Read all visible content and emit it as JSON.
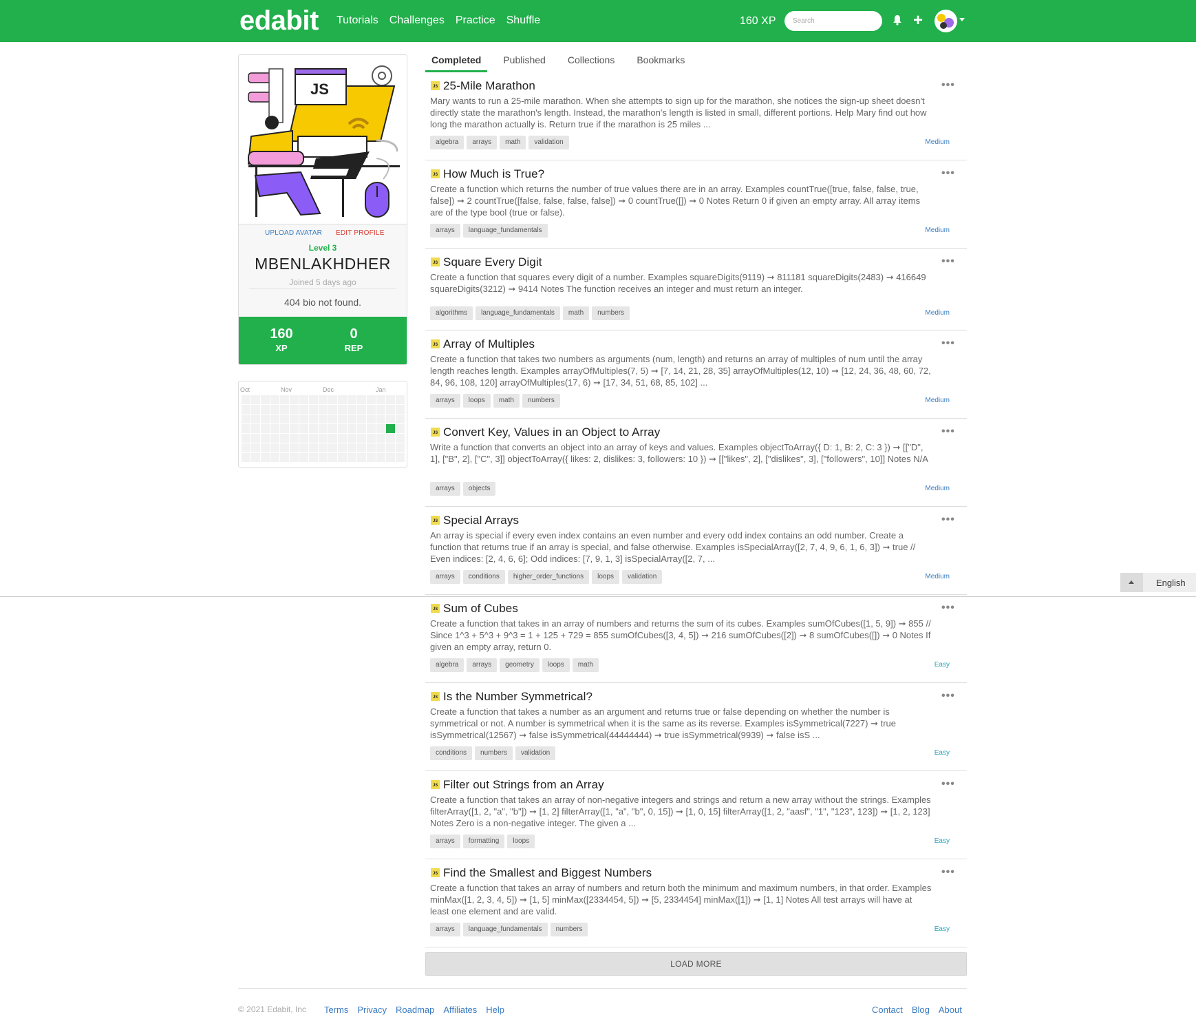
{
  "nav": {
    "logo": "edabit",
    "links": [
      "Tutorials",
      "Challenges",
      "Practice",
      "Shuffle"
    ],
    "xp": "160 XP",
    "search_placeholder": "Search"
  },
  "profile": {
    "illustration_text": "JS",
    "upload_avatar": "UPLOAD AVATAR",
    "edit_profile": "EDIT PROFILE",
    "level": "Level 3",
    "username": "MBENLAKHDHER",
    "joined": "Joined 5 days ago",
    "bio": "404 bio not found.",
    "xp_value": "160",
    "xp_label": "XP",
    "rep_value": "0",
    "rep_label": "REP"
  },
  "activity": {
    "months": [
      "Oct",
      "Nov",
      "Dec",
      "Jan"
    ]
  },
  "tabs": [
    "Completed",
    "Published",
    "Collections",
    "Bookmarks"
  ],
  "challenges": [
    {
      "title": "25-Mile Marathon",
      "desc": "Mary wants to run a 25-mile marathon. When she attempts to sign up for the marathon, she notices the sign-up sheet doesn't directly state the marathon's length. Instead, the marathon's length is listed in small, different portions. Help Mary find out how long the marathon actually is. Return true if the marathon is 25 miles ...",
      "tags": [
        "algebra",
        "arrays",
        "math",
        "validation"
      ],
      "difficulty": "Medium"
    },
    {
      "title": "How Much is True?",
      "desc": "Create a function which returns the number of true values there are in an array. Examples countTrue([true, false, false, true, false]) ➞ 2 countTrue([false, false, false, false]) ➞ 0 countTrue([]) ➞ 0 Notes Return 0 if given an empty array. All array items are of the type bool (true or false).",
      "tags": [
        "arrays",
        "language_fundamentals"
      ],
      "difficulty": "Medium"
    },
    {
      "title": "Square Every Digit",
      "desc": "Create a function that squares every digit of a number. Examples squareDigits(9119) ➞ 811181 squareDigits(2483) ➞ 416649 squareDigits(3212) ➞ 9414 Notes The function receives an integer and must return an integer.",
      "tags": [
        "algorithms",
        "language_fundamentals",
        "math",
        "numbers"
      ],
      "difficulty": "Medium"
    },
    {
      "title": "Array of Multiples",
      "desc": "Create a function that takes two numbers as arguments (num, length) and returns an array of multiples of num until the array length reaches length. Examples arrayOfMultiples(7, 5) ➞ [7, 14, 21, 28, 35] arrayOfMultiples(12, 10) ➞ [12, 24, 36, 48, 60, 72, 84, 96, 108, 120] arrayOfMultiples(17, 6) ➞ [17, 34, 51, 68, 85, 102] ...",
      "tags": [
        "arrays",
        "loops",
        "math",
        "numbers"
      ],
      "difficulty": "Medium"
    },
    {
      "title": "Convert Key, Values in an Object to Array",
      "desc": "Write a function that converts an object into an array of keys and values. Examples objectToArray({ D: 1, B: 2, C: 3 }) ➞ [[\"D\", 1], [\"B\", 2], [\"C\", 3]] objectToArray({ likes: 2, dislikes: 3, followers: 10 }) ➞ [[\"likes\", 2], [\"dislikes\", 3], [\"followers\", 10]] Notes N/A",
      "tags": [
        "arrays",
        "objects"
      ],
      "difficulty": "Medium"
    },
    {
      "title": "Special Arrays",
      "desc": "An array is special if every even index contains an even number and every odd index contains an odd number. Create a function that returns true if an array is special, and false otherwise. Examples isSpecialArray([2, 7, 4, 9, 6, 1, 6, 3]) ➞ true // Even indices: [2, 4, 6, 6]; Odd indices: [7, 9, 1, 3] isSpecialArray([2, 7, ...",
      "tags": [
        "arrays",
        "conditions",
        "higher_order_functions",
        "loops",
        "validation"
      ],
      "difficulty": "Medium"
    },
    {
      "title": "Sum of Cubes",
      "desc": "Create a function that takes in an array of numbers and returns the sum of its cubes. Examples sumOfCubes([1, 5, 9]) ➞ 855 // Since 1^3 + 5^3 + 9^3 = 1 + 125 + 729 = 855 sumOfCubes([3, 4, 5]) ➞ 216 sumOfCubes([2]) ➞ 8 sumOfCubes([]) ➞ 0 Notes If given an empty array, return 0.",
      "tags": [
        "algebra",
        "arrays",
        "geometry",
        "loops",
        "math"
      ],
      "difficulty": "Easy"
    },
    {
      "title": "Is the Number Symmetrical?",
      "desc": "Create a function that takes a number as an argument and returns true or false depending on whether the number is symmetrical or not. A number is symmetrical when it is the same as its reverse. Examples isSymmetrical(7227) ➞ true isSymmetrical(12567) ➞ false isSymmetrical(44444444) ➞ true isSymmetrical(9939) ➞ false isS ...",
      "tags": [
        "conditions",
        "numbers",
        "validation"
      ],
      "difficulty": "Easy"
    },
    {
      "title": "Filter out Strings from an Array",
      "desc": "Create a function that takes an array of non-negative integers and strings and return a new array without the strings. Examples filterArray([1, 2, \"a\", \"b\"]) ➞ [1, 2] filterArray([1, \"a\", \"b\", 0, 15]) ➞ [1, 0, 15] filterArray([1, 2, \"aasf\", \"1\", \"123\", 123]) ➞ [1, 2, 123] Notes Zero is a non-negative integer. The given a ...",
      "tags": [
        "arrays",
        "formatting",
        "loops"
      ],
      "difficulty": "Easy"
    },
    {
      "title": "Find the Smallest and Biggest Numbers",
      "desc": "Create a function that takes an array of numbers and return both the minimum and maximum numbers, in that order. Examples minMax([1, 2, 3, 4, 5]) ➞ [1, 5] minMax([2334454, 5]) ➞ [5, 2334454] minMax([1]) ➞ [1, 1] Notes All test arrays will have at least one element and are valid.",
      "tags": [
        "arrays",
        "language_fundamentals",
        "numbers"
      ],
      "difficulty": "Easy"
    }
  ],
  "load_more": "LOAD MORE",
  "language": "English",
  "footer": {
    "copyright": "© 2021 Edabit, Inc",
    "links_left": [
      "Terms",
      "Privacy",
      "Roadmap",
      "Affiliates",
      "Help"
    ],
    "links_right": [
      "Contact",
      "Blog",
      "About"
    ]
  },
  "colors": {
    "brand": "#21b04b",
    "link": "#3a7bbf",
    "danger": "#d9382c",
    "easy": "#2aa3b8"
  }
}
